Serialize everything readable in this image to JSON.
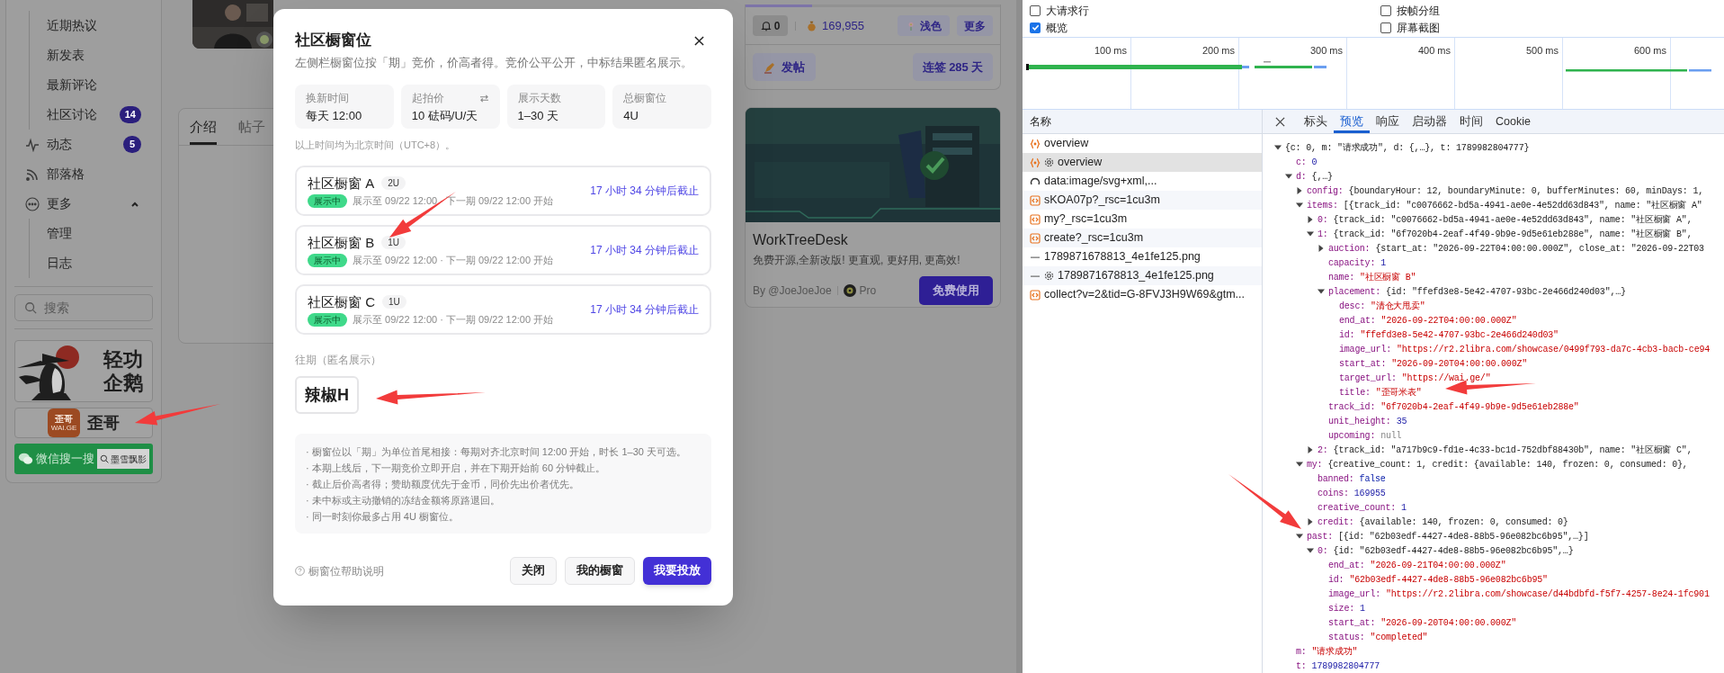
{
  "sidebar": {
    "sub_items": [
      {
        "label": "近期热议"
      },
      {
        "label": "新发表"
      },
      {
        "label": "最新评论"
      },
      {
        "label": "社区讨论",
        "badge": "14"
      }
    ],
    "items": [
      {
        "label": "动态",
        "badge": "5"
      },
      {
        "label": "部落格"
      },
      {
        "label": "更多",
        "expanded": true,
        "children": [
          {
            "label": "管理"
          },
          {
            "label": "日志"
          }
        ]
      }
    ],
    "search": {
      "placeholder": "搜索"
    },
    "banners": [
      {
        "kind": "penguin",
        "lines": [
          "轻功",
          "企鹅"
        ]
      },
      {
        "kind": "waige",
        "logo_lines": [
          "歪哥",
          "WAI.GE"
        ],
        "text": "歪哥"
      },
      {
        "kind": "wechat",
        "text": "微信搜一搜",
        "query": "墨雪飘影"
      }
    ]
  },
  "profile_tabs": [
    {
      "label": "介绍",
      "selected": true
    },
    {
      "label": "帖子",
      "selected": false
    }
  ],
  "account": {
    "progress": {
      "level": 0.26
    },
    "notifications": "0",
    "coins": "169,955",
    "theme_button": "浅色",
    "more_button": "更多",
    "post_button": "发帖",
    "checkin_button": "连签 285 天"
  },
  "ad": {
    "title": "WorkTreeDesk",
    "description": "免费开源,全新改版! 更直观, 更好用, 更高效!",
    "author": "By @JoeJoeJoe",
    "tier": "Pro",
    "cta": "免费使用"
  },
  "modal": {
    "title": "社区橱窗位",
    "subtitle": "左侧栏橱窗位按「期」竞价，价高者得。竞价公平公开，中标结果匿名展示。",
    "stats": [
      {
        "label": "换新时间",
        "value": "每天 12:00",
        "swap_icon": false
      },
      {
        "label": "起拍价",
        "value": "10 砝码/U/天",
        "swap_icon": true
      },
      {
        "label": "展示天数",
        "value": "1–30 天",
        "swap_icon": false
      },
      {
        "label": "总橱窗位",
        "value": "4U",
        "swap_icon": false
      }
    ],
    "timezone_note": "以上时间均为北京时间（UTC+8）。",
    "slots": [
      {
        "name": "社区橱窗 A",
        "size": "2U",
        "status": "展示中",
        "schedule": "展示至 09/22 12:00 · 下一期 09/22 12:00 开始",
        "deadline": "17 小时 34 分钟后截止"
      },
      {
        "name": "社区橱窗 B",
        "size": "1U",
        "status": "展示中",
        "schedule": "展示至 09/22 12:00 · 下一期 09/22 12:00 开始",
        "deadline": "17 小时 34 分钟后截止"
      },
      {
        "name": "社区橱窗 C",
        "size": "1U",
        "status": "展示中",
        "schedule": "展示至 09/22 12:00 · 下一期 09/22 12:00 开始",
        "deadline": "17 小时 34 分钟后截止"
      }
    ],
    "past_label": "往期（匿名展示）",
    "past": [
      {
        "text": "辣椒H"
      }
    ],
    "rules": [
      "· 橱窗位以「期」为单位首尾相接：每期对齐北京时间 12:00 开始，时长 1–30 天可选。",
      "· 本期上线后，下一期竞价立即开启，并在下期开始前 60 分钟截止。",
      "· 截止后价高者得；赞助额度优先于金币，同价先出价者优先。",
      "· 未中标或主动撤销的冻结金额将原路退回。",
      "· 同一时刻你最多占用 4U 橱窗位。"
    ],
    "help_link": "橱窗位帮助说明",
    "buttons": [
      {
        "label": "关闭",
        "kind": "secondary"
      },
      {
        "label": "我的橱窗",
        "kind": "secondary"
      },
      {
        "label": "我要投放",
        "kind": "primary"
      }
    ]
  },
  "devtools": {
    "options": [
      {
        "label": "大请求行",
        "checked": false
      },
      {
        "label": "按帧分组",
        "checked": false
      },
      {
        "label": "概览",
        "checked": true
      },
      {
        "label": "屏幕截图",
        "checked": false
      }
    ],
    "timeline_ticks": [
      "100 ms",
      "200 ms",
      "300 ms",
      "400 ms",
      "500 ms",
      "600 ms"
    ],
    "requests_header": "名称",
    "requests": [
      {
        "name": "overview",
        "kind": "fetch",
        "gear": false,
        "selected": false
      },
      {
        "name": "overview",
        "kind": "fetch",
        "gear": true,
        "selected": true
      },
      {
        "name": "data:image/svg+xml,...",
        "kind": "svg",
        "gear": false,
        "selected": false
      },
      {
        "name": "sKOA07p?_rsc=1cu3m",
        "kind": "doc",
        "gear": false,
        "selected": false
      },
      {
        "name": "my?_rsc=1cu3m",
        "kind": "doc",
        "gear": false,
        "selected": false
      },
      {
        "name": "create?_rsc=1cu3m",
        "kind": "doc",
        "gear": false,
        "selected": false
      },
      {
        "name": "1789871678813_4e1fe125.png",
        "gear": false,
        "selected": false
      },
      {
        "name": "1789871678813_4e1fe125.png",
        "gear": true,
        "selected": false
      },
      {
        "name": "collect?v=2&tid=G-8FVJ3H9W69&gtm...",
        "kind": "doc",
        "gear": false,
        "selected": false
      }
    ],
    "detail_tabs": [
      {
        "label": "标头",
        "selected": false
      },
      {
        "label": "预览",
        "selected": true
      },
      {
        "label": "响应",
        "selected": false
      },
      {
        "label": "启动器",
        "selected": false
      },
      {
        "label": "时间",
        "selected": false
      },
      {
        "label": "Cookie",
        "selected": false
      }
    ],
    "preview_tree": [
      {
        "value": "{c: 0, m: \"请求成功\", d: {,…}, t: 1789982804777}",
        "kind": "preview",
        "expanded": true,
        "children": [
          {
            "key": "c:",
            "value": "0",
            "kind": "number"
          },
          {
            "key": "d:",
            "value": "{,…}",
            "kind": "preview",
            "expanded": true,
            "children": [
              {
                "key": "config:",
                "value": "{boundaryHour: 12, boundaryMinute: 0, bufferMinutes: 60, minDays: 1,",
                "kind": "preview",
                "expanded": false
              },
              {
                "key": "items:",
                "value": "[{track_id: \"c0076662-bd5a-4941-ae0e-4e52dd63d843\", name: \"社区橱窗 A\"",
                "kind": "preview",
                "expanded": true,
                "children": [
                  {
                    "key": "0:",
                    "value": "{track_id: \"c0076662-bd5a-4941-ae0e-4e52dd63d843\", name: \"社区橱窗 A\",",
                    "kind": "preview",
                    "expanded": false
                  },
                  {
                    "key": "1:",
                    "value": "{track_id: \"6f7020b4-2eaf-4f49-9b9e-9d5e61eb288e\", name: \"社区橱窗 B\",",
                    "kind": "preview",
                    "expanded": true,
                    "children": [
                      {
                        "key": "auction:",
                        "value": "{start_at: \"2026-09-22T04:00:00.000Z\", close_at: \"2026-09-22T03",
                        "kind": "preview",
                        "expanded": false
                      },
                      {
                        "key": "capacity:",
                        "value": "1",
                        "kind": "number"
                      },
                      {
                        "key": "name:",
                        "value": "\"社区橱窗 B\"",
                        "kind": "string"
                      },
                      {
                        "key": "placement:",
                        "value": "{id: \"ffefd3e8-5e42-4707-93bc-2e466d240d03\",…}",
                        "kind": "preview",
                        "expanded": true,
                        "children": [
                          {
                            "key": "desc:",
                            "value": "\"清仓大甩卖\"",
                            "kind": "string"
                          },
                          {
                            "key": "end_at:",
                            "value": "\"2026-09-22T04:00:00.000Z\"",
                            "kind": "string"
                          },
                          {
                            "key": "id:",
                            "value": "\"ffefd3e8-5e42-4707-93bc-2e466d240d03\"",
                            "kind": "string"
                          },
                          {
                            "key": "image_url:",
                            "value": "\"https://r2.2libra.com/showcase/0499f793-da7c-4cb3-bacb-ce94",
                            "kind": "string"
                          },
                          {
                            "key": "start_at:",
                            "value": "\"2026-09-20T04:00:00.000Z\"",
                            "kind": "string"
                          },
                          {
                            "key": "target_url:",
                            "value": "\"https://wai.ge/\"",
                            "kind": "string"
                          },
                          {
                            "key": "title:",
                            "value": "\"歪哥米表\"",
                            "kind": "string"
                          }
                        ]
                      },
                      {
                        "key": "track_id:",
                        "value": "\"6f7020b4-2eaf-4f49-9b9e-9d5e61eb288e\"",
                        "kind": "string"
                      },
                      {
                        "key": "unit_height:",
                        "value": "35",
                        "kind": "number"
                      },
                      {
                        "key": "upcoming:",
                        "value": "null",
                        "kind": "null"
                      }
                    ]
                  },
                  {
                    "key": "2:",
                    "value": "{track_id: \"a717b9c9-fd1e-4c33-bc1d-752dbf88430b\", name: \"社区橱窗 C\",",
                    "kind": "preview",
                    "expanded": false
                  }
                ]
              },
              {
                "key": "my:",
                "value": "{creative_count: 1, credit: {available: 140, frozen: 0, consumed: 0},",
                "kind": "preview",
                "expanded": true,
                "children": [
                  {
                    "key": "banned:",
                    "value": "false",
                    "kind": "boolean"
                  },
                  {
                    "key": "coins:",
                    "value": "169955",
                    "kind": "number"
                  },
                  {
                    "key": "creative_count:",
                    "value": "1",
                    "kind": "number"
                  },
                  {
                    "key": "credit:",
                    "value": "{available: 140, frozen: 0, consumed: 0}",
                    "kind": "preview",
                    "expanded": false
                  }
                ]
              },
              {
                "key": "past:",
                "value": "[{id: \"62b03edf-4427-4de8-88b5-96e082bc6b95\",…}]",
                "kind": "preview",
                "expanded": true,
                "children": [
                  {
                    "key": "0:",
                    "value": "{id: \"62b03edf-4427-4de8-88b5-96e082bc6b95\",…}",
                    "kind": "preview",
                    "expanded": true,
                    "children": [
                      {
                        "key": "end_at:",
                        "value": "\"2026-09-21T04:00:00.000Z\"",
                        "kind": "string"
                      },
                      {
                        "key": "id:",
                        "value": "\"62b03edf-4427-4de8-88b5-96e082bc6b95\"",
                        "kind": "string"
                      },
                      {
                        "key": "image_url:",
                        "value": "\"https://r2.2libra.com/showcase/d44bdbfd-f5f7-4257-8e24-1fc901",
                        "kind": "string"
                      },
                      {
                        "key": "size:",
                        "value": "1",
                        "kind": "number"
                      },
                      {
                        "key": "start_at:",
                        "value": "\"2026-09-20T04:00:00.000Z\"",
                        "kind": "string"
                      },
                      {
                        "key": "status:",
                        "value": "\"completed\"",
                        "kind": "string"
                      }
                    ]
                  }
                ]
              }
            ]
          },
          {
            "key": "m:",
            "value": "\"请求成功\"",
            "kind": "string"
          },
          {
            "key": "t:",
            "value": "1789982804777",
            "kind": "number"
          }
        ]
      }
    ]
  }
}
